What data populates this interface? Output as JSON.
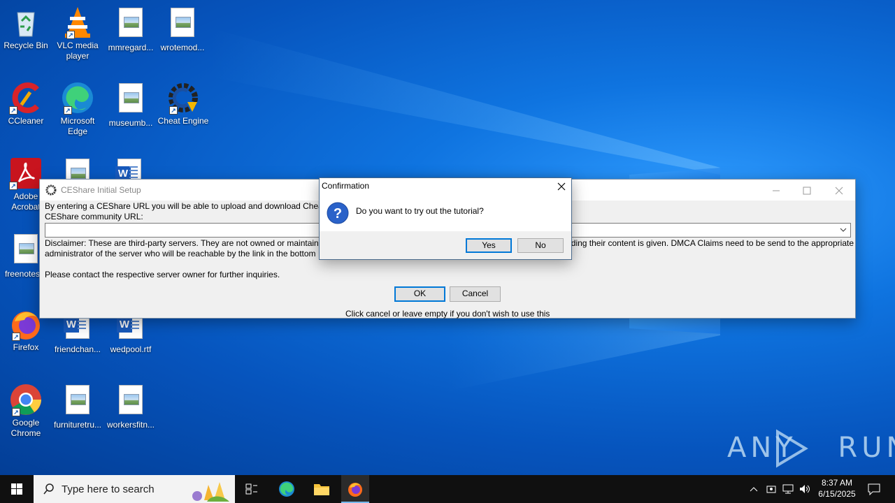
{
  "desktop": {
    "icons": [
      {
        "label": "Recycle Bin",
        "icon": "recycle-bin-icon"
      },
      {
        "label": "VLC media player",
        "icon": "vlc-icon"
      },
      {
        "label": "mmregard...",
        "icon": "image-file-icon"
      },
      {
        "label": "wrotemod...",
        "icon": "image-file-icon"
      },
      {
        "label": "CCleaner",
        "icon": "ccleaner-icon"
      },
      {
        "label": "Microsoft Edge",
        "icon": "edge-icon"
      },
      {
        "label": "museumb...",
        "icon": "image-file-icon"
      },
      {
        "label": "Cheat Engine",
        "icon": "cheat-engine-icon"
      },
      {
        "label": "Adobe Acrobat",
        "icon": "acrobat-icon"
      },
      {
        "label": "freenotes...",
        "icon": "image-file-icon"
      },
      {
        "label": "Firefox",
        "icon": "firefox-icon"
      },
      {
        "label": "friendchan...",
        "icon": "word-doc-icon"
      },
      {
        "label": "wedpool.rtf",
        "icon": "word-doc-icon"
      },
      {
        "label": "Google Chrome",
        "icon": "chrome-icon"
      },
      {
        "label": "furnituretru...",
        "icon": "image-file-icon"
      },
      {
        "label": "workersfitn...",
        "icon": "image-file-icon"
      }
    ]
  },
  "ceshare": {
    "title": "CEShare Initial Setup",
    "intro": "By entering a CEShare URL you will be able to upload and download Cheat",
    "url_label": "CEShare community URL:",
    "url_value": "",
    "disclaimer_left_1": "Disclaimer: These are third-party servers. They are not owned or maintained",
    "disclaimer_right_1": "ding their content is given.  DMCA Claims need to be send to the appropriate",
    "disclaimer_left_2": "administrator of the server who will be reachable by the link in the bottom",
    "contact": "Please contact the respective server owner for further inquiries.",
    "ok_label": "OK",
    "cancel_label": "Cancel",
    "hint": "Click cancel or leave empty if you don't wish to use this"
  },
  "confirm": {
    "title": "Confirmation",
    "message": "Do you want to try out the tutorial?",
    "yes_label": "Yes",
    "no_label": "No"
  },
  "taskbar": {
    "search_placeholder": "Type here to search",
    "time": "8:37 AM",
    "date": "6/15/2025"
  },
  "watermark": "ANY RUN",
  "colors": {
    "accent": "#0078d7",
    "taskbar": "#101010",
    "wallpaper": "#0a64c8"
  }
}
